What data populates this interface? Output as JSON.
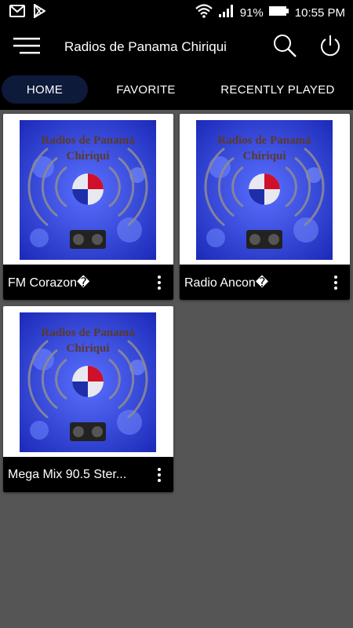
{
  "status_bar": {
    "battery": "91%",
    "time": "10:55 PM",
    "icons": [
      "gmail-icon",
      "play-store-icon",
      "wifi-icon",
      "signal-icon",
      "battery-icon"
    ]
  },
  "app_bar": {
    "title": "Radios de Panama Chiriqui",
    "icons": [
      "menu-icon",
      "search-icon",
      "power-icon"
    ]
  },
  "tabs": [
    {
      "label": "HOME",
      "active": true
    },
    {
      "label": "FAVORITE",
      "active": false
    },
    {
      "label": "RECENTLY PLAYED",
      "active": false
    }
  ],
  "stations": [
    {
      "name": "FM Corazon�",
      "art_line1": "Radios de Panamá",
      "art_line2": "Chiriqui"
    },
    {
      "name": "Radio Ancon�",
      "art_line1": "Radios de Panamá",
      "art_line2": "Chiriqui"
    },
    {
      "name": "Mega Mix 90.5 Ster...",
      "art_line1": "Radios de Panamá",
      "art_line2": "Chiriqui"
    }
  ],
  "colors": {
    "background": "#555555",
    "bar": "#000000",
    "active_tab": "#0e1a3a",
    "art_blue": "#2a3bd0"
  }
}
